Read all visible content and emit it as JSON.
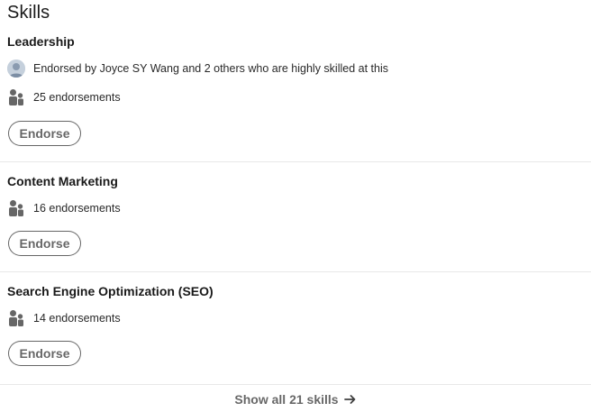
{
  "section": {
    "title": "Skills"
  },
  "skills": [
    {
      "name": "Leadership",
      "endorsed_by": "Endorsed by Joyce SY Wang and 2 others who are highly skilled at this",
      "endorsements": "25 endorsements",
      "button_label": "Endorse"
    },
    {
      "name": "Content Marketing",
      "endorsements": "16 endorsements",
      "button_label": "Endorse"
    },
    {
      "name": "Search Engine Optimization (SEO)",
      "endorsements": "14 endorsements",
      "button_label": "Endorse"
    }
  ],
  "footer": {
    "show_all_label": "Show all 21 skills",
    "arrow_icon": "arrow-right-icon"
  },
  "icons": {
    "people": "people-icon",
    "avatar": "avatar"
  },
  "colors": {
    "text_primary": "#191919",
    "text_secondary": "#666666",
    "divider": "#e8e8e8",
    "icon": "#666666"
  }
}
